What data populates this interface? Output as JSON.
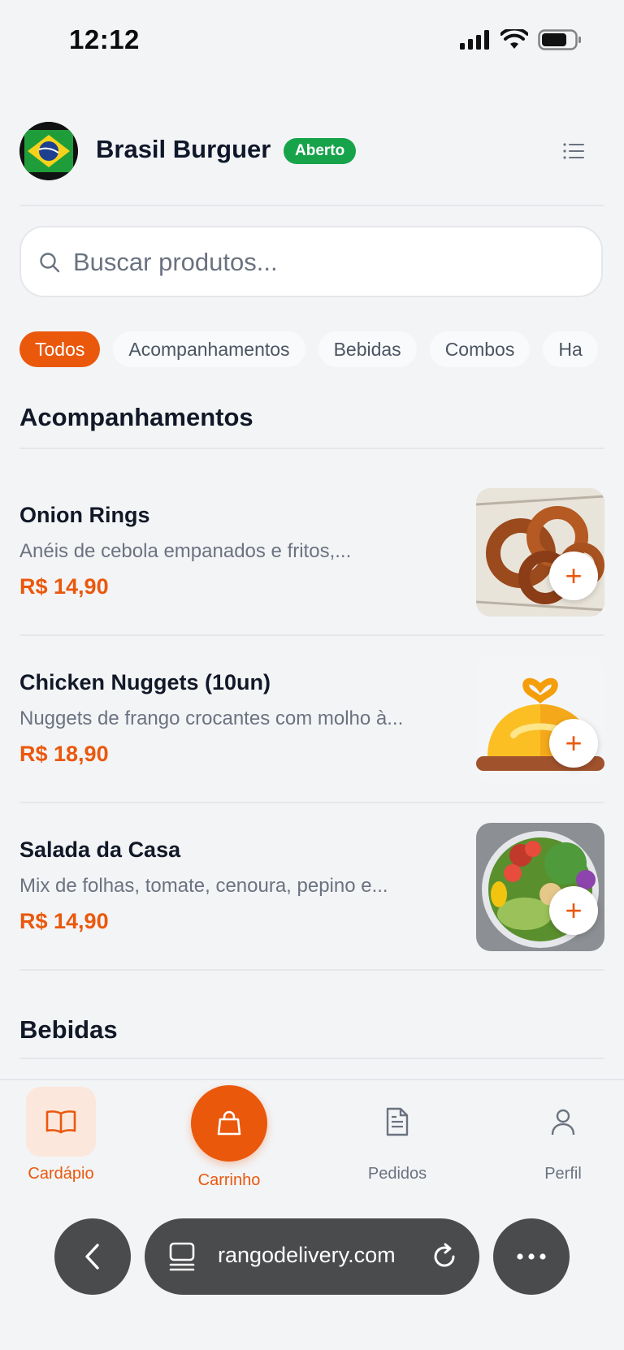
{
  "status_bar": {
    "time": "12:12"
  },
  "header": {
    "store_name": "Brasil Burguer",
    "status_badge": "Aberto"
  },
  "search": {
    "placeholder": "Buscar produtos..."
  },
  "categories": [
    {
      "label": "Todos",
      "active": true
    },
    {
      "label": "Acompanhamentos",
      "active": false
    },
    {
      "label": "Bebidas",
      "active": false
    },
    {
      "label": "Combos",
      "active": false
    },
    {
      "label": "Ha",
      "active": false
    }
  ],
  "sections": [
    {
      "title": "Acompanhamentos",
      "products": [
        {
          "name": "Onion Rings",
          "description": "Anéis de cebola empanados e fritos,...",
          "price": "R$ 14,90",
          "add_label": "+"
        },
        {
          "name": "Chicken Nuggets (10un)",
          "description": "Nuggets de frango crocantes com molho à...",
          "price": "R$ 18,90",
          "add_label": "+"
        },
        {
          "name": "Salada da Casa",
          "description": "Mix de folhas, tomate, cenoura, pepino e...",
          "price": "R$ 14,90",
          "add_label": "+"
        }
      ]
    },
    {
      "title": "Bebidas",
      "products": []
    }
  ],
  "bottom_nav": {
    "items": [
      {
        "label": "Cardápio",
        "icon": "book-icon",
        "active": true
      },
      {
        "label": "Carrinho",
        "icon": "shopping-bag-icon",
        "active": false
      },
      {
        "label": "Pedidos",
        "icon": "document-icon",
        "active": false
      },
      {
        "label": "Perfil",
        "icon": "user-icon",
        "active": false
      }
    ]
  },
  "browser": {
    "url": "rangodelivery.com"
  },
  "colors": {
    "accent": "#ea580c",
    "success": "#16a34a",
    "background": "#f3f4f6"
  }
}
